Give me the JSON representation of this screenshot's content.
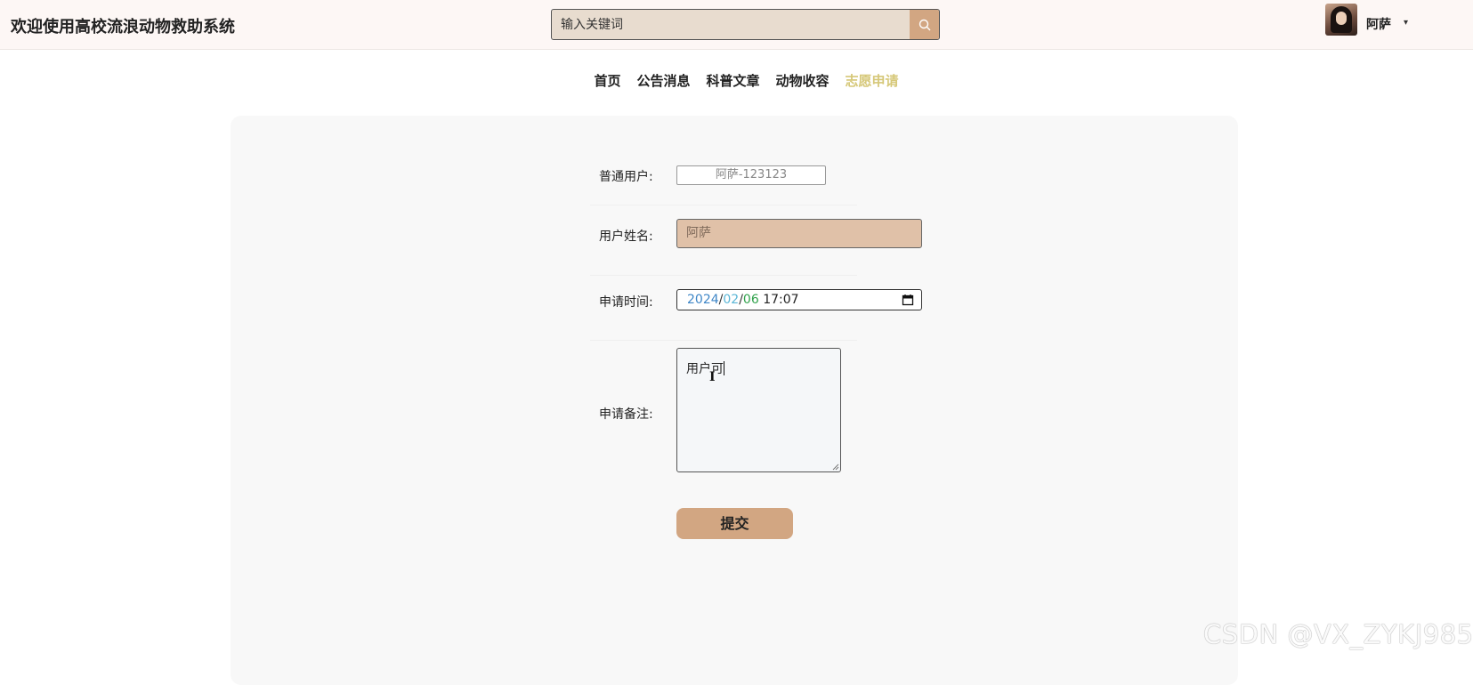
{
  "header": {
    "site_title": "欢迎使用高校流浪动物救助系统",
    "search_placeholder": "输入关键词",
    "user_name": "阿萨",
    "user_caret": "▾"
  },
  "nav": {
    "items": [
      {
        "label": "首页",
        "active": false
      },
      {
        "label": "公告消息",
        "active": false
      },
      {
        "label": "科普文章",
        "active": false
      },
      {
        "label": "动物收容",
        "active": false
      },
      {
        "label": "志愿申请",
        "active": true
      }
    ]
  },
  "form": {
    "user_label": "普通用户:",
    "user_value": "阿萨-123123",
    "name_label": "用户姓名:",
    "name_value": "阿萨",
    "date_label": "申请时间:",
    "date_year": "2024",
    "date_sep": "/",
    "date_month": "02",
    "date_day": "06",
    "date_time": "17:07",
    "notes_label": "申请备注:",
    "notes_value": "用户可",
    "submit_label": "提交"
  },
  "watermark": "CSDN @VX_ZYKJ985",
  "colors": {
    "accent": "#d2a682",
    "active_nav": "#d6c879",
    "name_field_bg": "#e0c1a8"
  },
  "icons": {
    "search": "search-icon",
    "calendar": "calendar-icon",
    "dropdown": "chevron-down-icon"
  }
}
